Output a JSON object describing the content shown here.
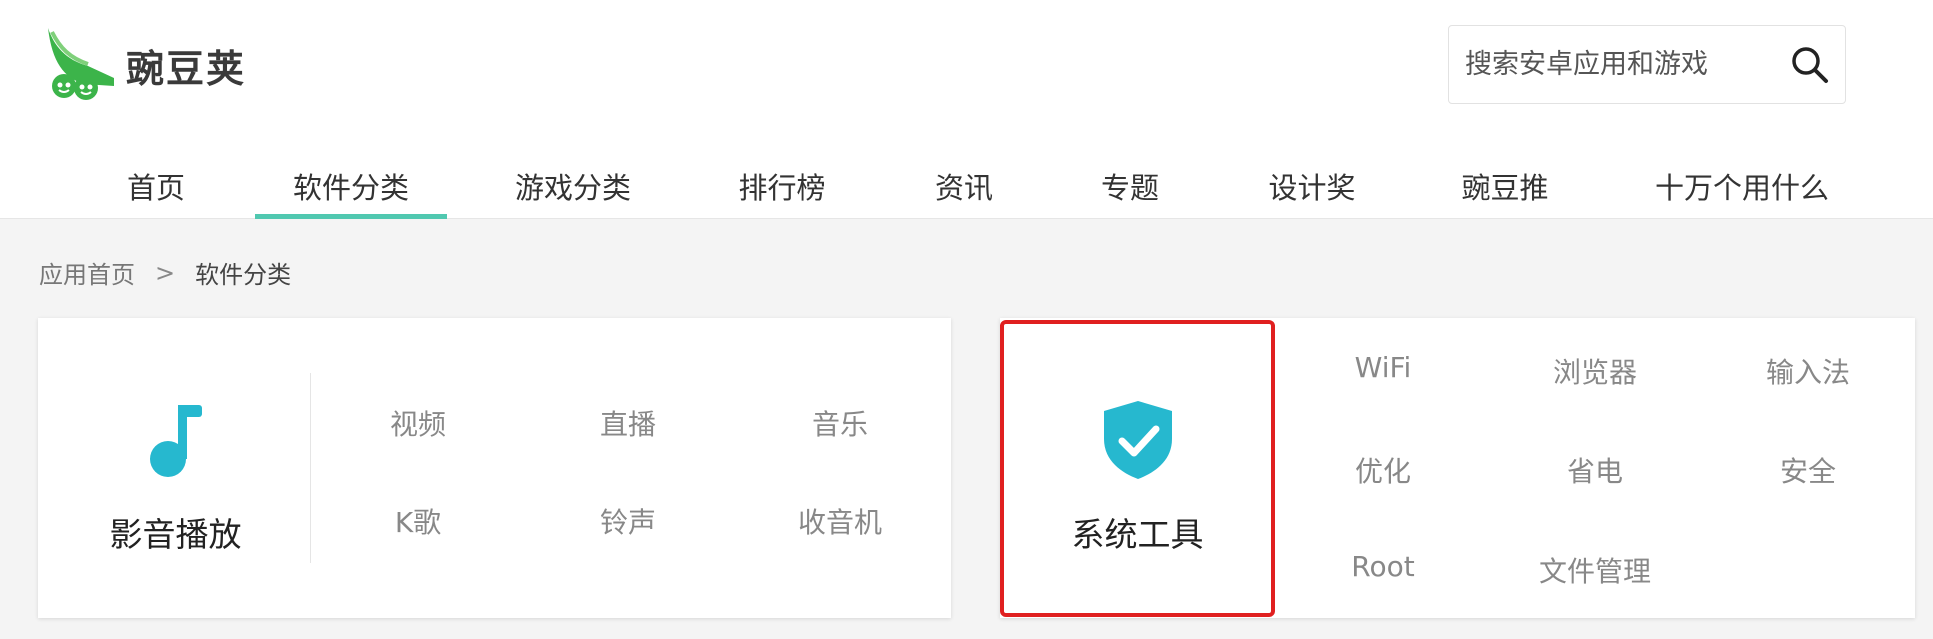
{
  "brand": {
    "name": "豌豆荚",
    "accent": "#50c8b0",
    "logo_color": "#3cb44a"
  },
  "search": {
    "placeholder": "搜索安卓应用和游戏",
    "value": ""
  },
  "nav": {
    "items": [
      {
        "label": "首页"
      },
      {
        "label": "软件分类",
        "active": true
      },
      {
        "label": "游戏分类"
      },
      {
        "label": "排行榜"
      },
      {
        "label": "资讯"
      },
      {
        "label": "专题"
      },
      {
        "label": "设计奖"
      },
      {
        "label": "豌豆推"
      },
      {
        "label": "十万个用什么"
      }
    ]
  },
  "breadcrumb": {
    "home": "应用首页",
    "separator": ">",
    "current": "软件分类"
  },
  "categories": [
    {
      "title": "影音播放",
      "icon": "music-note-icon",
      "icon_color": "#26b8cf",
      "subs": [
        "视频",
        "直播",
        "音乐",
        "K歌",
        "铃声",
        "收音机"
      ]
    },
    {
      "title": "系统工具",
      "icon": "shield-check-icon",
      "icon_color": "#26b8cf",
      "highlight_color": "#e02020",
      "subs": [
        "WiFi",
        "浏览器",
        "输入法",
        "优化",
        "省电",
        "安全",
        "Root",
        "文件管理"
      ]
    }
  ]
}
